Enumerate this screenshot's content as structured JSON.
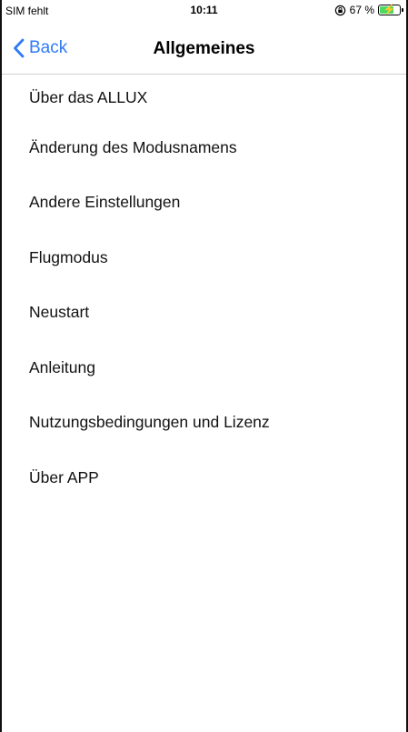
{
  "status_bar": {
    "carrier": "SIM fehlt",
    "time": "10:11",
    "battery_text": "67 %",
    "battery_level": 0.67,
    "icons": [
      "rotation-lock-icon",
      "battery-charging-icon"
    ]
  },
  "nav": {
    "back_label": "Back",
    "title": "Allgemeines"
  },
  "menu": {
    "items": [
      {
        "label": "Über das ALLUX"
      },
      {
        "label": "Änderung des Modusnamens"
      },
      {
        "label": "Andere Einstellungen"
      },
      {
        "label": "Flugmodus"
      },
      {
        "label": "Neustart"
      },
      {
        "label": "Anleitung"
      },
      {
        "label": "Nutzungsbedingungen und Lizenz"
      },
      {
        "label": "Über APP"
      }
    ]
  },
  "colors": {
    "accent": "#2f7bf5",
    "battery_fill": "#4cd964",
    "separator": "#cfcfd3"
  }
}
